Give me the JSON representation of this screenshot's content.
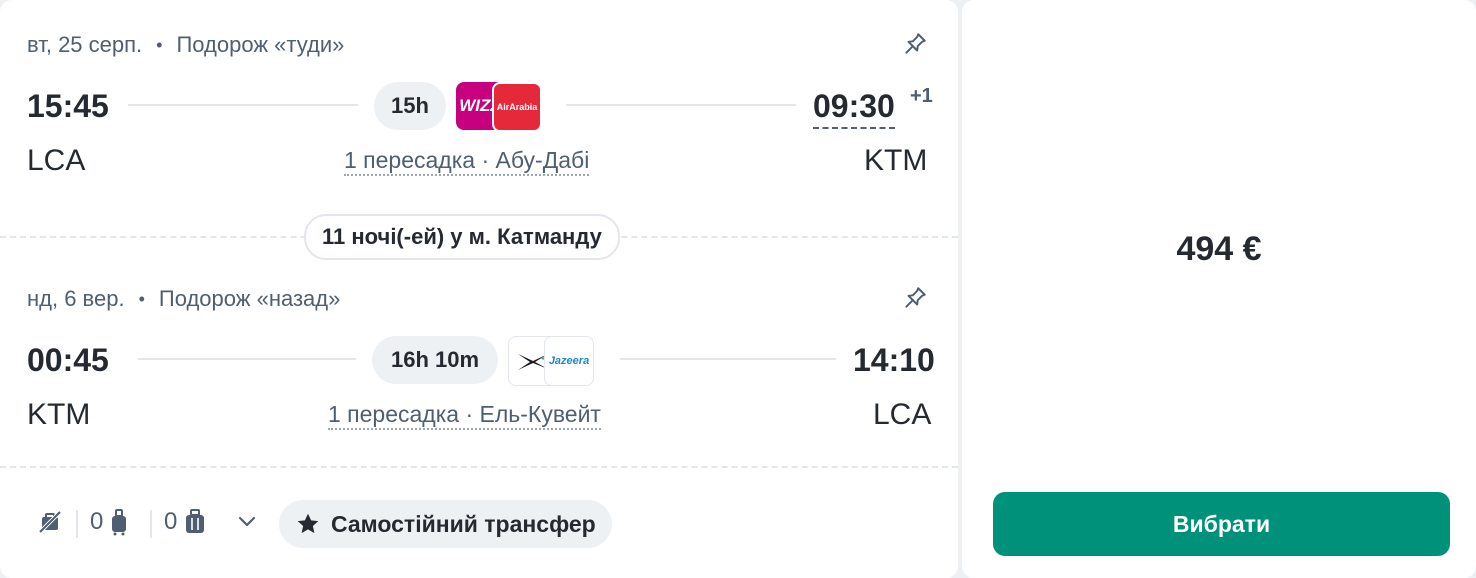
{
  "outbound": {
    "date": "вт, 25 серп.",
    "separator": "•",
    "direction": "Подорож «туди»",
    "depart_time": "15:45",
    "arrive_time": "09:30",
    "day_offset": "+1",
    "duration": "15h",
    "from": "LCA",
    "to": "KTM",
    "stops": "1 пересадка · Абу-Дабі",
    "airlines": [
      {
        "name": "wizz-air",
        "logo_text": "WIZZ",
        "bg": "#c6007e"
      },
      {
        "name": "air-arabia",
        "logo_text": "AirArabia",
        "bg": "#e6283b"
      }
    ]
  },
  "stay": {
    "label": "11 ночі(-ей) у м. Катманду"
  },
  "inbound": {
    "date": "нд, 6 вер.",
    "separator": "•",
    "direction": "Подорож «назад»",
    "depart_time": "00:45",
    "arrive_time": "14:10",
    "duration": "16h 10m",
    "from": "KTM",
    "to": "LCA",
    "stops": "1 пересадка · Ель-Кувейт",
    "airlines": [
      {
        "name": "kuwait-airways",
        "logo_text": "",
        "bg": "#ffffff"
      },
      {
        "name": "jazeera-airways",
        "logo_text": "Jazeera",
        "bg": "#ffffff"
      }
    ]
  },
  "baggage": {
    "personal_item_icon": "no-personal-item-icon",
    "cabin_count": "0",
    "checked_count": "0",
    "expand_icon": "chevron-down-icon"
  },
  "transfer": {
    "label": "Самостійний трансфер",
    "icon": "star-icon"
  },
  "price": {
    "amount": "494 €"
  },
  "actions": {
    "select_label": "Вибрати"
  },
  "colors": {
    "accent": "#00917b",
    "text": "#252a31",
    "secondary": "#4f5e71",
    "divider": "#e3e7ec",
    "chip_bg": "#eef1f4"
  }
}
